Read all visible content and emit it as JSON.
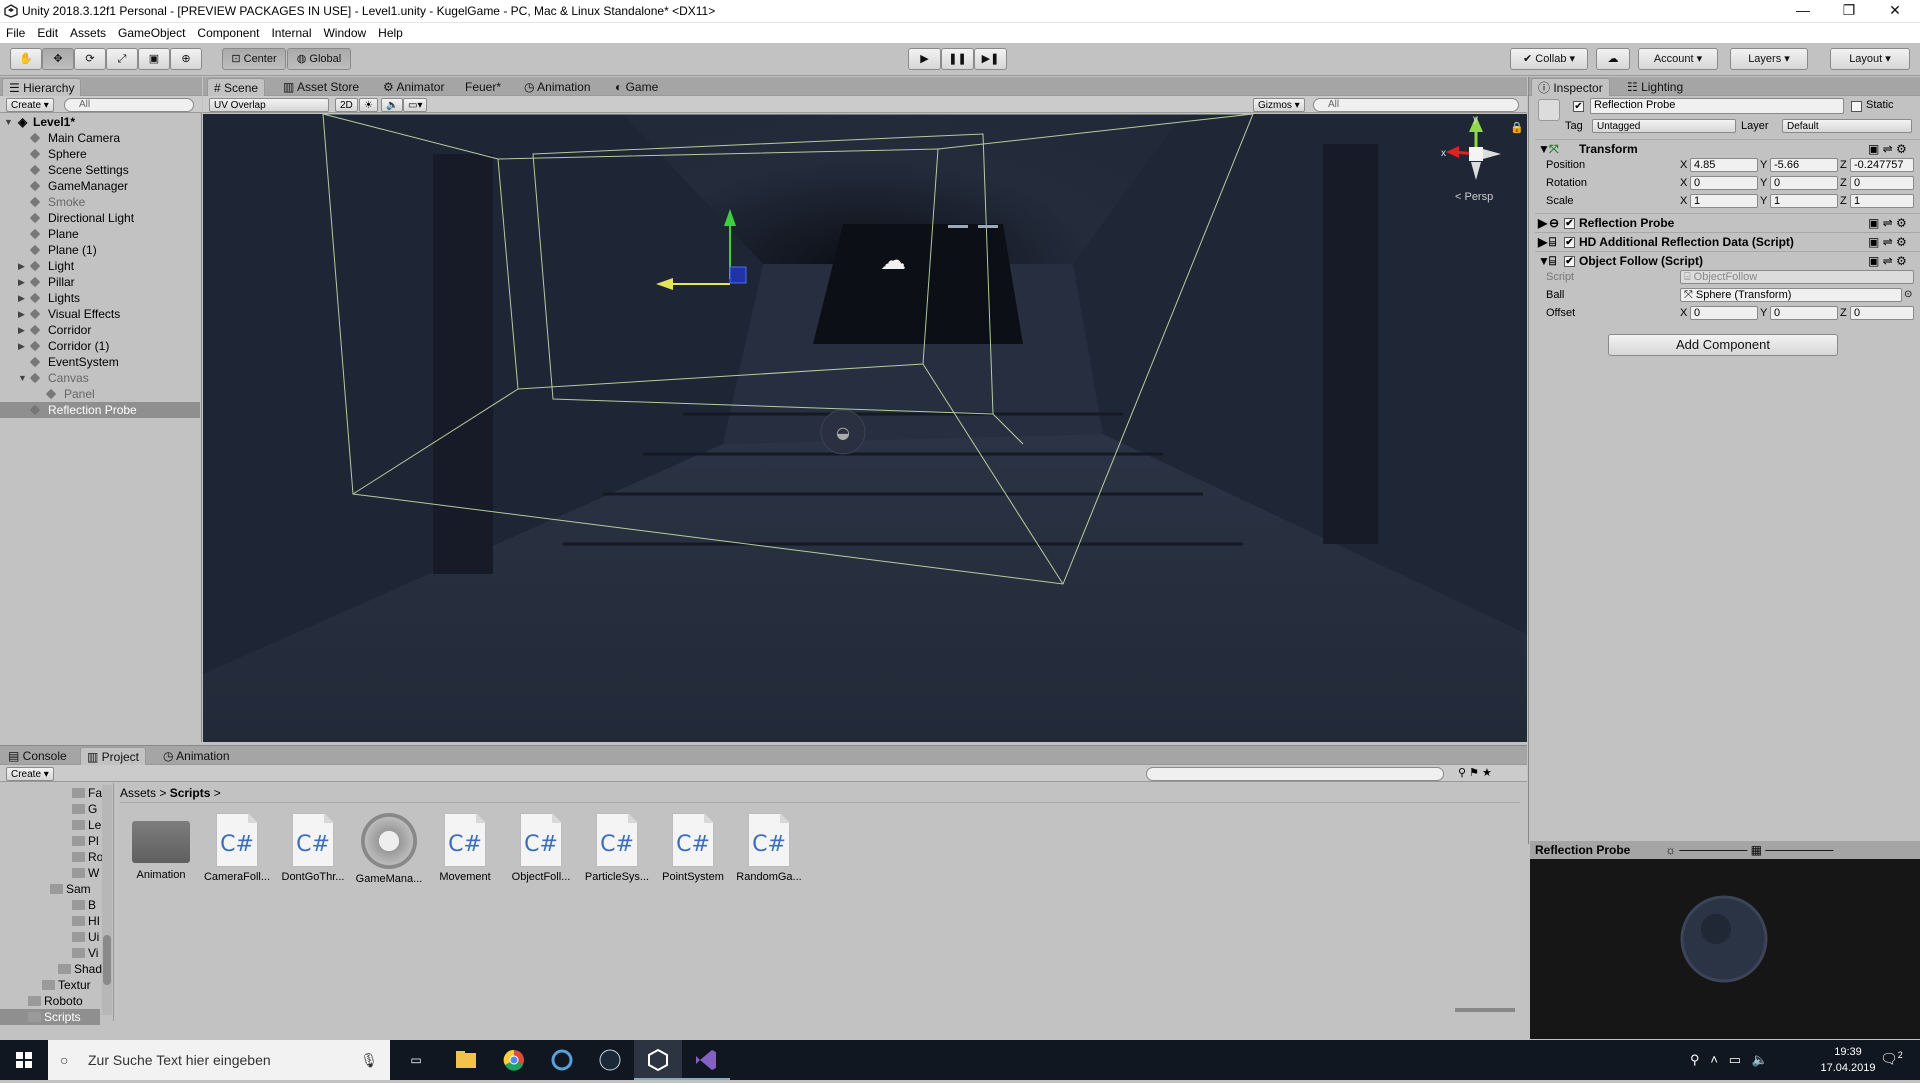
{
  "window": {
    "title": "Unity 2018.3.12f1 Personal - [PREVIEW PACKAGES IN USE] - Level1.unity - KugelGame - PC, Mac & Linux Standalone* <DX11>",
    "controls": [
      "—",
      "❐",
      "✕"
    ]
  },
  "menubar": [
    "File",
    "Edit",
    "Assets",
    "GameObject",
    "Component",
    "Internal",
    "Window",
    "Help"
  ],
  "toolbar": {
    "pivot": "Center",
    "space": "Global",
    "collab": "Collab",
    "account": "Account",
    "layers": "Layers",
    "layout": "Layout"
  },
  "hierarchy": {
    "tab": "Hierarchy",
    "create": "Create",
    "search": "All",
    "scene": "Level1*",
    "items": [
      {
        "label": "Main Camera"
      },
      {
        "label": "Sphere"
      },
      {
        "label": "Scene Settings"
      },
      {
        "label": "GameManager"
      },
      {
        "label": "Smoke"
      },
      {
        "label": "Directional Light"
      },
      {
        "label": "Plane"
      },
      {
        "label": "Plane (1)"
      },
      {
        "label": "Light"
      },
      {
        "label": "Pillar"
      },
      {
        "label": "Lights"
      },
      {
        "label": "Visual Effects"
      },
      {
        "label": "Corridor"
      },
      {
        "label": "Corridor (1)"
      },
      {
        "label": "EventSystem"
      },
      {
        "label": "Canvas"
      },
      {
        "label": "Panel"
      },
      {
        "label": "Reflection Probe"
      }
    ]
  },
  "scene_view": {
    "tabs": [
      "Scene",
      "Asset Store",
      "Animator",
      "Feuer*",
      "Animation",
      "Game"
    ],
    "draw_mode": "UV Overlap",
    "mode_2d": "2D",
    "gizmos": "Gizmos",
    "search": "All",
    "persp": "< Persp",
    "gizmo_axes": [
      "x",
      "y"
    ]
  },
  "inspector": {
    "tabs": [
      "Inspector",
      "Lighting"
    ],
    "object_name": "Reflection Probe",
    "static_label": "Static",
    "tag_label": "Tag",
    "tag_value": "Untagged",
    "layer_label": "Layer",
    "layer_value": "Default",
    "transform": {
      "title": "Transform",
      "position_label": "Position",
      "rotation_label": "Rotation",
      "scale_label": "Scale",
      "position": [
        "4.85",
        "-5.66",
        "-0.247757"
      ],
      "rotation": [
        "0",
        "0",
        "0"
      ],
      "scale": [
        "1",
        "1",
        "1"
      ]
    },
    "axis": [
      "X",
      "Y",
      "Z"
    ],
    "components": [
      "Reflection Probe",
      "HD Additional Reflection Data (Script)",
      "Object Follow (Script)"
    ],
    "object_follow": {
      "script_label": "Script",
      "script_value": "ObjectFollow",
      "ball_label": "Ball",
      "ball_value": "Sphere (Transform)",
      "offset_label": "Offset",
      "offset": [
        "0",
        "0",
        "0"
      ]
    },
    "add_component": "Add Component",
    "preview_title": "Reflection Probe"
  },
  "bottom": {
    "tabs": [
      "Console",
      "Project",
      "Animation"
    ],
    "create": "Create",
    "breadcrumb": [
      "Assets",
      "Scripts"
    ],
    "tree": [
      "Fa",
      "G",
      "Le",
      "Pl",
      "Ro",
      "W",
      "Sam",
      "B",
      "HI",
      "Ui",
      "Vi",
      "Shad",
      "Textur",
      "Roboto",
      "Scripts"
    ],
    "assets": [
      {
        "label": "Animation",
        "type": "folder"
      },
      {
        "label": "CameraFoll...",
        "type": "cs"
      },
      {
        "label": "DontGoThr...",
        "type": "cs"
      },
      {
        "label": "GameMana...",
        "type": "gear"
      },
      {
        "label": "Movement",
        "type": "cs"
      },
      {
        "label": "ObjectFoll...",
        "type": "cs"
      },
      {
        "label": "ParticleSys...",
        "type": "cs"
      },
      {
        "label": "PointSystem",
        "type": "cs"
      },
      {
        "label": "RandomGa...",
        "type": "cs"
      }
    ],
    "cs_glyph": "C#"
  },
  "taskbar": {
    "search_placeholder": "Zur Suche Text hier eingeben",
    "time": "19:39",
    "date": "17.04.2019",
    "notif_count": "2"
  }
}
